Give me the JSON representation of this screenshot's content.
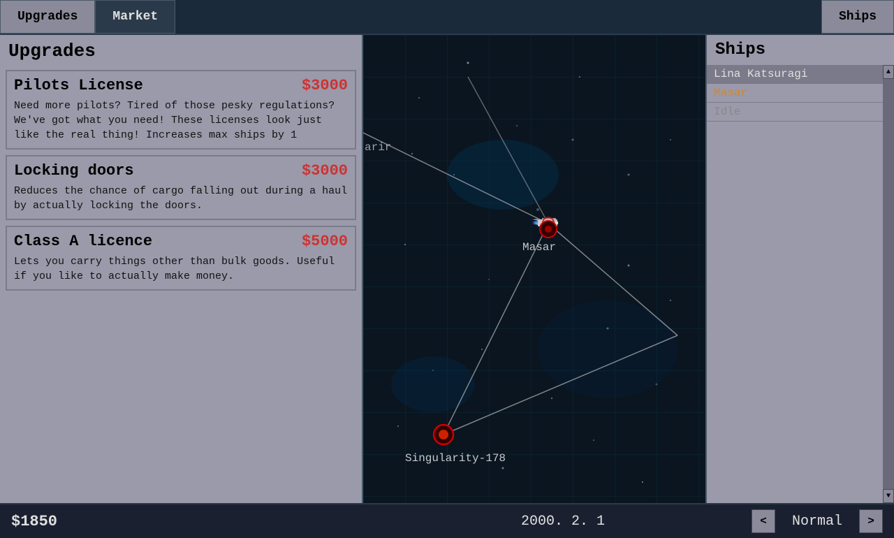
{
  "nav": {
    "upgrades_tab": "Upgrades",
    "market_tab": "Market",
    "ships_tab": "Ships"
  },
  "upgrades": {
    "title": "Upgrades",
    "items": [
      {
        "name": "Pilots License",
        "price": "$3000",
        "description": "Need more pilots? Tired of those pesky regulations? We've got what you need! These licenses look just like the real thing! Increases max ships by 1"
      },
      {
        "name": "Locking doors",
        "price": "$3000",
        "description": "Reduces the chance of cargo falling out during a haul by actually locking the doors."
      },
      {
        "name": "Class A licence",
        "price": "$5000",
        "description": "Lets you carry things other than bulk goods. Useful if you like to actually make money."
      }
    ]
  },
  "ships": {
    "title": "Ships",
    "items": [
      {
        "name": "Lina Katsuragi",
        "status": "active"
      },
      {
        "name": "Masar",
        "status": "active"
      },
      {
        "name": "Idle",
        "status": "idle"
      }
    ]
  },
  "map": {
    "planet_masar": "Masar",
    "planet_singularity": "Singularity-178",
    "corner_label": "arir"
  },
  "bottom_bar": {
    "balance": "$1850",
    "date": "2000. 2. 1",
    "difficulty": "Normal",
    "prev_btn": "<",
    "next_btn": ">"
  }
}
